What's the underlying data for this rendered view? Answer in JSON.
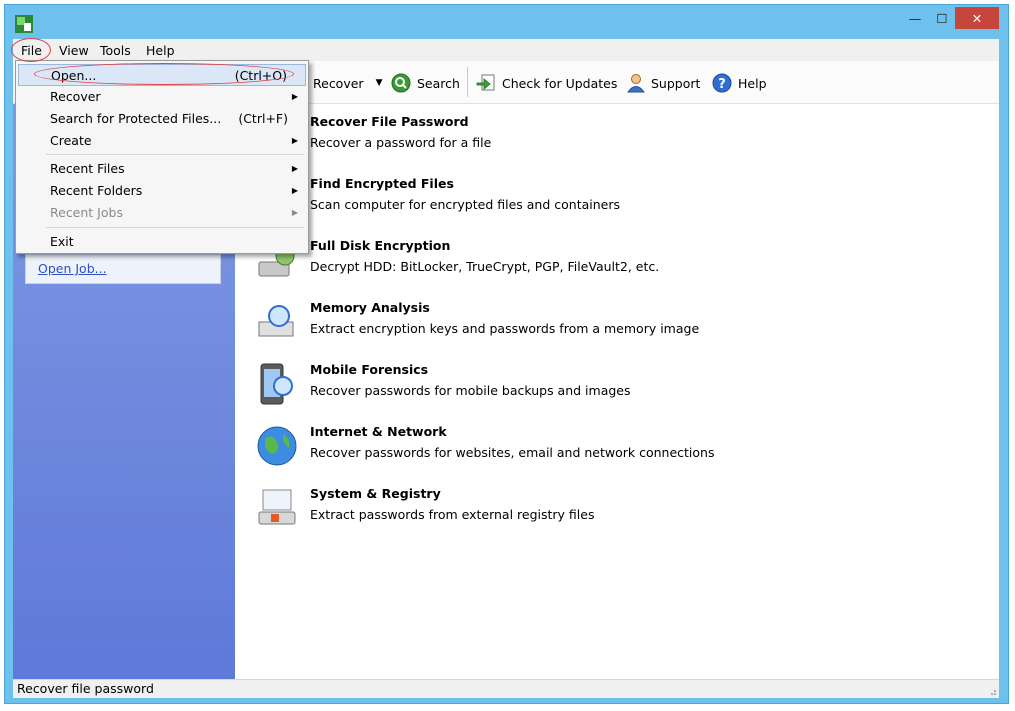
{
  "window": {
    "close_glyph": "✕",
    "min_glyph": "—",
    "max_glyph": "☐"
  },
  "menubar": {
    "items": [
      "File",
      "View",
      "Tools",
      "Help"
    ]
  },
  "toolbar": {
    "recover": "Recover",
    "search": "Search",
    "check_updates": "Check for Updates",
    "support": "Support",
    "help": "Help"
  },
  "sidebar": {
    "open_job": "Open Job..."
  },
  "tasks": [
    {
      "title": "Recover File Password",
      "desc": "Recover a password for a file",
      "icon": "file-key-icon"
    },
    {
      "title": "Find Encrypted Files",
      "desc": "Scan computer for encrypted files and containers",
      "icon": "search-files-icon"
    },
    {
      "title": "Full Disk Encryption",
      "desc": "Decrypt HDD: BitLocker, TrueCrypt, PGP, FileVault2, etc.",
      "icon": "hard-disk-icon"
    },
    {
      "title": "Memory Analysis",
      "desc": "Extract encryption keys and passwords from a memory image",
      "icon": "memory-chip-icon"
    },
    {
      "title": "Mobile Forensics",
      "desc": "Recover passwords for mobile backups and images",
      "icon": "mobile-phone-icon"
    },
    {
      "title": "Internet & Network",
      "desc": "Recover passwords for websites, email and network connections",
      "icon": "globe-icon"
    },
    {
      "title": "System & Registry",
      "desc": "Extract passwords from external registry files",
      "icon": "registry-computer-icon"
    }
  ],
  "file_menu": {
    "open": "Open...",
    "open_shortcut": "(Ctrl+O)",
    "recover": "Recover",
    "search_protected": "Search for Protected Files...",
    "search_shortcut": "(Ctrl+F)",
    "create": "Create",
    "recent_files": "Recent Files",
    "recent_folders": "Recent Folders",
    "recent_jobs": "Recent Jobs",
    "exit": "Exit"
  },
  "status": {
    "text": "Recover file password"
  }
}
